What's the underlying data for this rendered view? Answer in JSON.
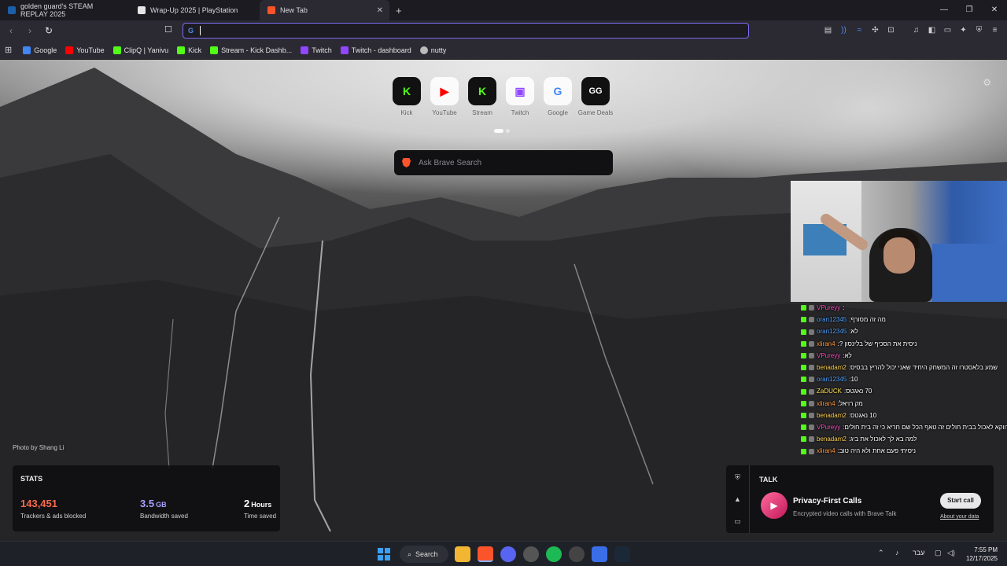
{
  "tabs": [
    {
      "title": "golden guard's STEAM REPLAY 2025",
      "color": "#1b5fa8"
    },
    {
      "title": "Wrap-Up 2025 | PlayStation",
      "color": "#e6e6e6"
    },
    {
      "title": "New Tab",
      "color": "#fb542b",
      "active": true
    }
  ],
  "toolbar": {
    "url_value": "",
    "search_engine": "G"
  },
  "bookmarks": [
    {
      "label": "Google",
      "color": "#4285f4"
    },
    {
      "label": "YouTube",
      "color": "#ff0000"
    },
    {
      "label": "ClipQ | Yanivu",
      "color": "#53fc18"
    },
    {
      "label": "Kick",
      "color": "#53fc18"
    },
    {
      "label": "Stream - Kick Dashb...",
      "color": "#53fc18"
    },
    {
      "label": "Twitch",
      "color": "#9146ff"
    },
    {
      "label": "Twitch - dashboard",
      "color": "#9146ff"
    },
    {
      "label": "nutty",
      "color": "#bbbbbb"
    }
  ],
  "tiles": [
    {
      "label": "Kick",
      "glyph": "K",
      "color": "#53fc18"
    },
    {
      "label": "YouTube",
      "glyph": "▶",
      "color": "#ff0000"
    },
    {
      "label": "Stream",
      "glyph": "K",
      "color": "#53fc18"
    },
    {
      "label": "Twitch",
      "glyph": "▣",
      "color": "#9146ff"
    },
    {
      "label": "Google",
      "glyph": "G",
      "color": "#4285f4"
    },
    {
      "label": "Game Deals",
      "glyph": "GG",
      "color": "#111111"
    }
  ],
  "search": {
    "placeholder": "Ask Brave Search"
  },
  "photo_credit": "Photo by Shang Li",
  "stats": {
    "title": "STATS",
    "trackers": {
      "value": "143,451",
      "desc": "Trackers & ads blocked",
      "color": "#fb6b4b"
    },
    "bandwidth": {
      "value": "3.5",
      "unit": "GB",
      "desc": "Bandwidth saved",
      "color": "#a8a0ff"
    },
    "time": {
      "value": "2",
      "unit": "Hours",
      "desc": "Time saved",
      "color": "#ffffff"
    }
  },
  "chat": [
    {
      "user": "VPureyy",
      "text": "",
      "color": "#ff4fc8"
    },
    {
      "user": "oran12345",
      "text": "מה זה מסורף",
      "color": "#4fa3ff"
    },
    {
      "user": "oran12345",
      "text": "לא",
      "color": "#4fa3ff"
    },
    {
      "user": "xliran4",
      "text": "ניסית את הסכיף של בלינסון ?",
      "color": "#ff9a3c"
    },
    {
      "user": "VPureyy",
      "text": "לא",
      "color": "#ff4fc8"
    },
    {
      "user": "benadam2",
      "text": "שמע בלאסטרו זה המשחק היחיד שאני יכול להריץ בבסיס",
      "color": "#ffd24f"
    },
    {
      "user": "oran12345",
      "text": "10",
      "color": "#4fa3ff"
    },
    {
      "user": "ZaDUCK",
      "text": "70 נאגטס",
      "color": "#ffe24f"
    },
    {
      "user": "xliran4",
      "text": "מק רויאל",
      "color": "#ff9a3c"
    },
    {
      "user": "benadam2",
      "text": "10 נאגטס",
      "color": "#ffd24f"
    },
    {
      "user": "VPureyy",
      "text": "דווקא לאכול בבית חולים זה טאף הכל שם חריא כי זה בית חולים",
      "color": "#ff4fc8"
    },
    {
      "user": "benadam2",
      "text": "למה בא לך לאכול את ביג",
      "color": "#ffd24f"
    },
    {
      "user": "xliran4",
      "text": "ניסיתי פעם אחת ולא היה טוב",
      "color": "#ff9a3c"
    }
  ],
  "talk": {
    "title": "TALK",
    "heading": "Privacy-First Calls",
    "desc": "Encrypted video calls with Brave Talk",
    "button": "Start call",
    "link": "About your data"
  },
  "taskbar": {
    "search_label": "Search",
    "lang": "עבר",
    "time": "7:55 PM",
    "date": "12/17/2025"
  }
}
